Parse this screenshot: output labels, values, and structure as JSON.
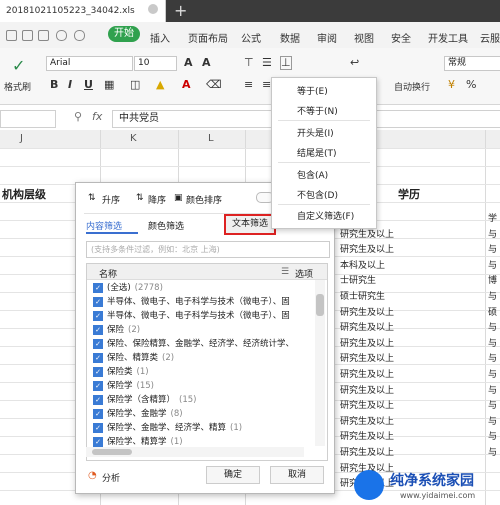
{
  "titlebar": {
    "filename": "20181021105223_34042.xls",
    "newtab": "+"
  },
  "menubar": {
    "items": [
      "开始",
      "插入",
      "页面布局",
      "公式",
      "数据",
      "审阅",
      "视图",
      "安全",
      "开发工具",
      "云服"
    ]
  },
  "toolbar": {
    "paste_label": "格式刷",
    "font_name": "Arial",
    "font_size": "10",
    "wrap_label": "自动换行",
    "numformat": "常规"
  },
  "formula": {
    "fx": "fx",
    "value": "中共党员"
  },
  "sheet": {
    "columns": [
      "J",
      "K",
      "L"
    ],
    "col_right_label": "学历",
    "header_left": "机构层级",
    "edu_rows": [
      "研究生",
      "研究生及以上",
      "研究生及以上",
      "本科及以上",
      "士研究生",
      "硕士研究生",
      "研究生及以上",
      "研究生及以上",
      "研究生及以上",
      "研究生及以上",
      "研究生及以上",
      "研究生及以上",
      "研究生及以上",
      "研究生及以上",
      "研究生及以上",
      "研究生及以上",
      "研究生及以上",
      "研究生及以上"
    ],
    "right_edge_rows": [
      "学",
      "与",
      "与",
      "与",
      "博",
      "与",
      "硕",
      "与",
      "与",
      "与",
      "与",
      "与",
      "与",
      "与",
      "与",
      "与"
    ]
  },
  "filter_dialog": {
    "sort_asc": "升序",
    "sort_desc": "降序",
    "sort_color": "颜色排序",
    "tab_content": "内容筛选",
    "tab_color": "颜色筛选",
    "tab_text": "文本筛选",
    "search_placeholder": "(支持多条件过滤，例如：北京  上海)",
    "list_header": "名称",
    "options_label": "选项",
    "items": [
      {
        "label": "(全选)",
        "count": "(2778)"
      },
      {
        "label": "半导体、微电子、电子科学与技术（微电子）、固",
        "count": ""
      },
      {
        "label": "半导体、微电子、电子科学与技术（微电子）、固",
        "count": ""
      },
      {
        "label": "保险",
        "count": "(2)"
      },
      {
        "label": "保险、保险精算、金融学、经济学、经济统计学、",
        "count": ""
      },
      {
        "label": "保险、精算类",
        "count": "(2)"
      },
      {
        "label": "保险类",
        "count": "(1)"
      },
      {
        "label": "保险学",
        "count": "(15)"
      },
      {
        "label": "保险学（含精算）",
        "count": "(15)"
      },
      {
        "label": "保险学、金融学",
        "count": "(8)"
      },
      {
        "label": "保险学、金融学、经济学、精算",
        "count": "(1)"
      },
      {
        "label": "保险学、精算学",
        "count": "(1)"
      }
    ],
    "analysis_label": "分析",
    "ok_label": "确定",
    "cancel_label": "取消"
  },
  "text_filter_menu": {
    "items": [
      "等于(E)",
      "不等于(N)",
      "开头是(I)",
      "结尾是(T)",
      "包含(A)",
      "不包含(D)",
      "自定义筛选(F)"
    ]
  },
  "watermark": {
    "title": "纯净系统家园",
    "url": "www.yidaimei.com"
  }
}
